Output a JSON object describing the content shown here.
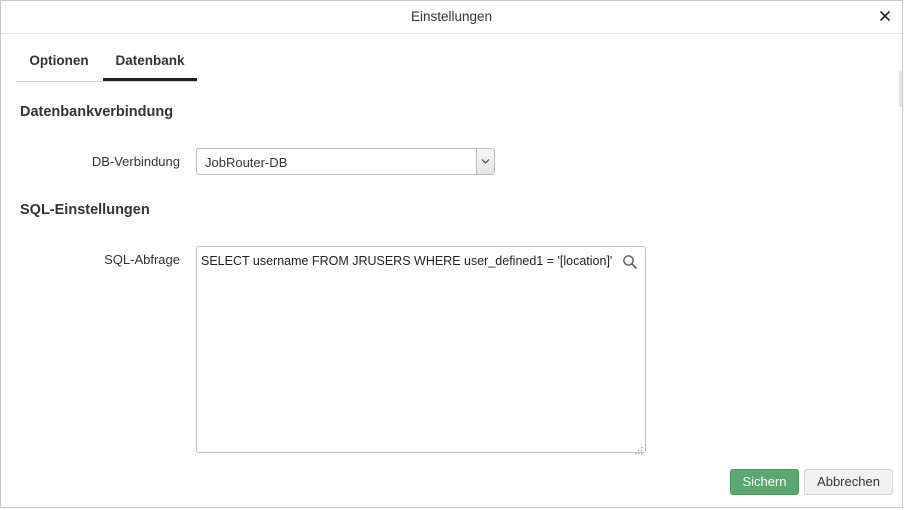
{
  "dialog": {
    "title": "Einstellungen",
    "close_icon": "close-icon"
  },
  "tabs": [
    {
      "label": "Optionen",
      "active": false
    },
    {
      "label": "Datenbank",
      "active": true
    }
  ],
  "sections": {
    "db": {
      "title": "Datenbankverbindung",
      "connection_label": "DB-Verbindung",
      "connection_value": "JobRouter-DB"
    },
    "sql": {
      "title": "SQL-Einstellungen",
      "query_label": "SQL-Abfrage",
      "query_value": "SELECT username FROM JRUSERS WHERE user_defined1 = '[location]'",
      "search_icon": "search-icon"
    }
  },
  "buttons": {
    "save_label": "Sichern",
    "cancel_label": "Abbrechen"
  },
  "colors": {
    "save_button": "#5aa86e",
    "active_tab_underline": "#222222"
  }
}
